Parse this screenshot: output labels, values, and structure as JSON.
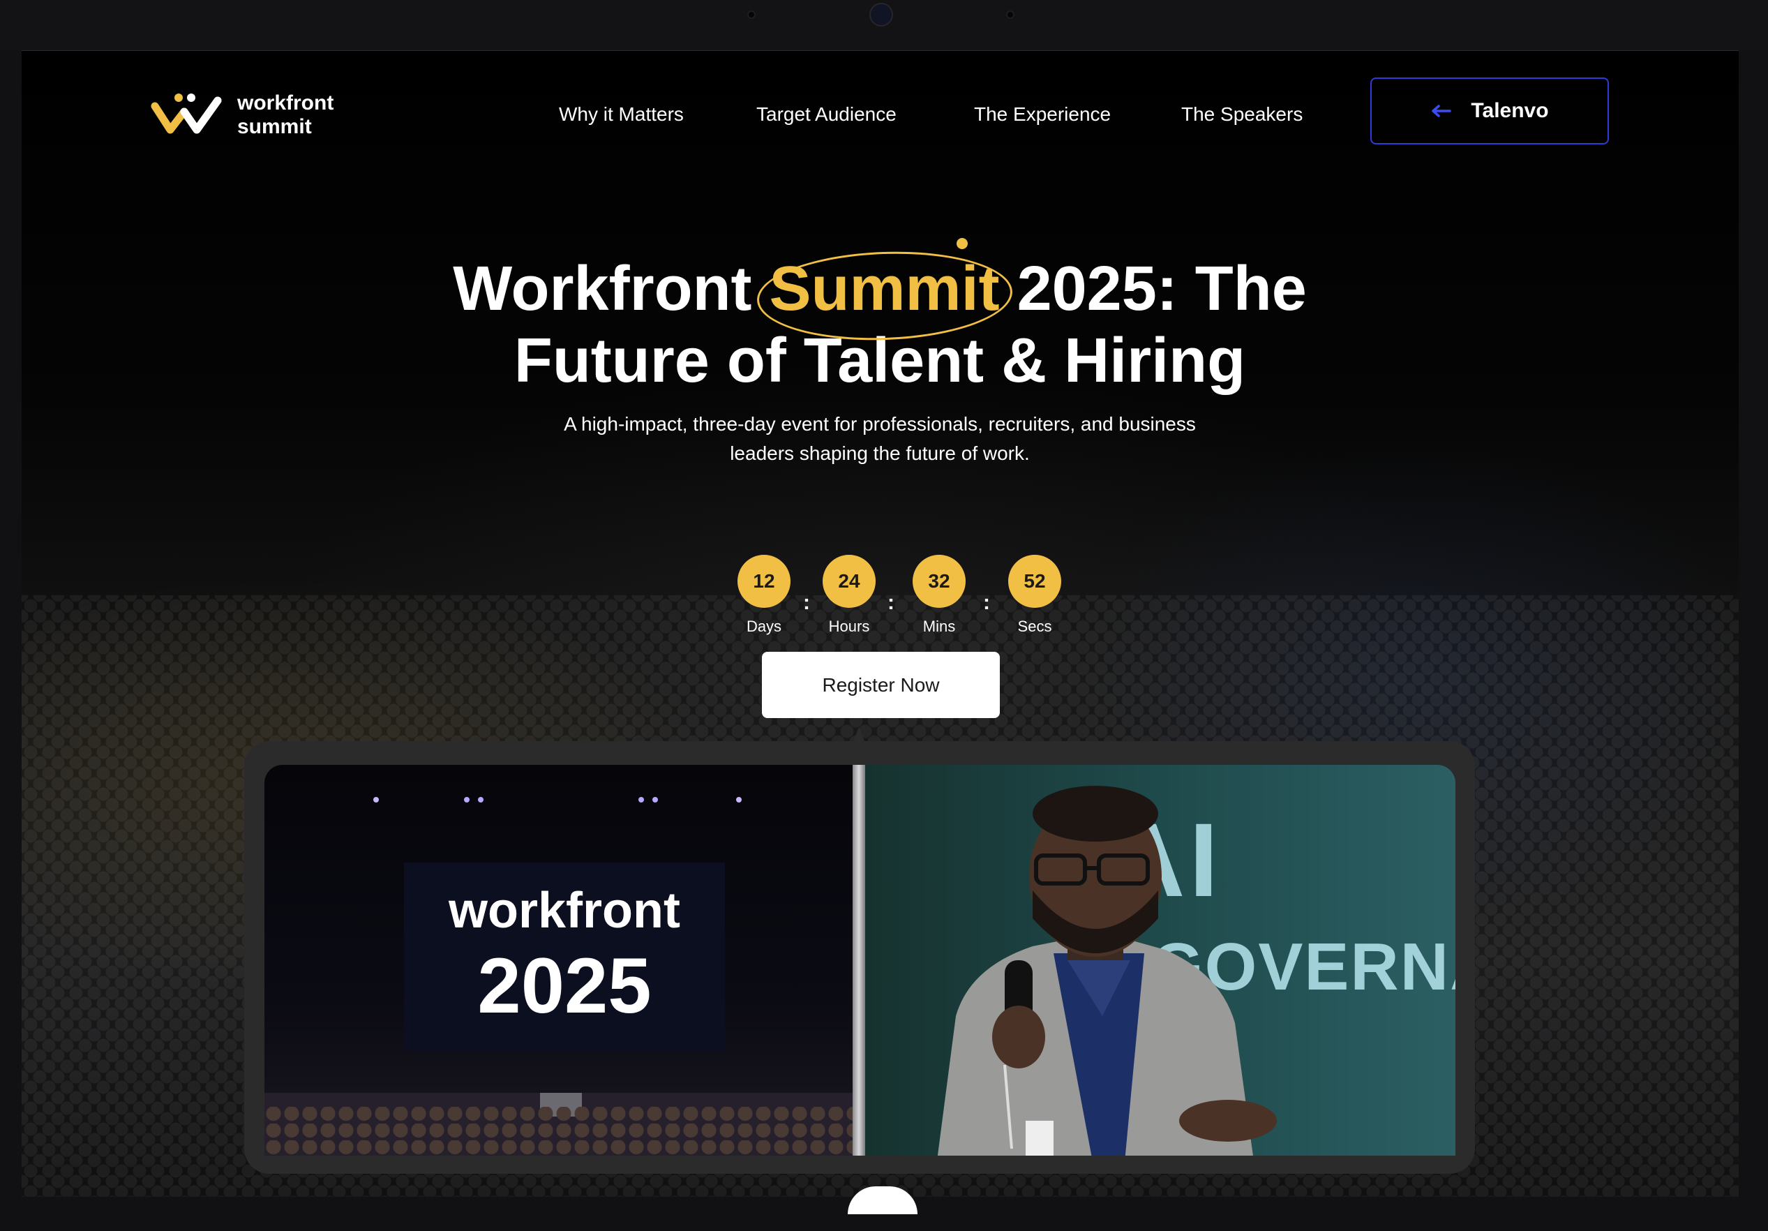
{
  "brand": {
    "line1": "workfront",
    "line2": "summit"
  },
  "nav": {
    "links": [
      "Why it Matters",
      "Target Audience",
      "The Experience",
      "The Speakers"
    ],
    "button_label": "Talenvo"
  },
  "hero": {
    "title_part1": "Workfront",
    "title_accent": "Summit",
    "title_part2": "2025: The",
    "title_line2": "Future of Talent & Hiring",
    "subtitle_line1": "A high-impact, three-day event for professionals, recruiters, and business",
    "subtitle_line2": "leaders shaping the future of work.",
    "cta_label": "Register Now"
  },
  "countdown": {
    "units": [
      {
        "value": "12",
        "label": "Days"
      },
      {
        "value": "24",
        "label": "Hours"
      },
      {
        "value": "32",
        "label": "Mins"
      },
      {
        "value": "52",
        "label": "Secs"
      }
    ],
    "separator": ":"
  },
  "media": {
    "left_screen_line1": "workfront",
    "left_screen_line2": "2025",
    "right_banner_line1": "AI",
    "right_banner_line2": "GOVERNAN"
  },
  "colors": {
    "accent": "#f2bf45",
    "nav_button_border": "#2f3bd9",
    "background": "#000000"
  },
  "icons": {
    "nav_button": "arrow-left-icon",
    "logo": "workfront-logo-icon"
  }
}
